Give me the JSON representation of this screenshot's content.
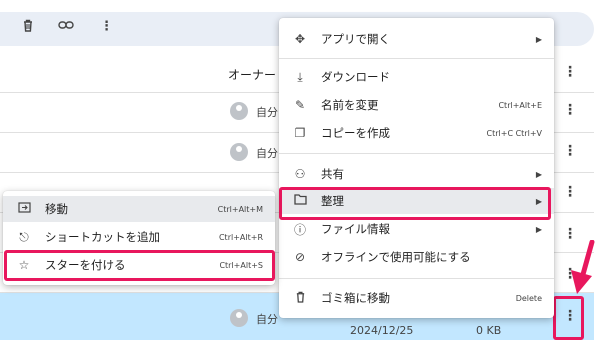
{
  "toolbar": {
    "icons": [
      "trash-icon",
      "link-icon",
      "more-vert-icon"
    ]
  },
  "list": {
    "owner_header": "オーナー",
    "owner_label": "自分",
    "date": "2024/12/25",
    "size": "0 KB"
  },
  "context_menu": {
    "items": [
      {
        "icon": "open-with-icon",
        "label": "アプリで開く",
        "shortcut": "",
        "submenu": true
      },
      {
        "icon": "download-icon",
        "label": "ダウンロード",
        "shortcut": "",
        "submenu": false
      },
      {
        "icon": "rename-icon",
        "label": "名前を変更",
        "shortcut": "Ctrl+Alt+E",
        "submenu": false
      },
      {
        "icon": "copy-icon",
        "label": "コピーを作成",
        "shortcut": "Ctrl+C Ctrl+V",
        "submenu": false
      },
      {
        "icon": "share-icon",
        "label": "共有",
        "shortcut": "",
        "submenu": true
      },
      {
        "icon": "folder-icon",
        "label": "整理",
        "shortcut": "",
        "submenu": true
      },
      {
        "icon": "info-icon",
        "label": "ファイル情報",
        "shortcut": "",
        "submenu": true
      },
      {
        "icon": "offline-icon",
        "label": "オフラインで使用可能にする",
        "shortcut": "",
        "submenu": false
      },
      {
        "icon": "trash-icon",
        "label": "ゴミ箱に移動",
        "shortcut": "Delete",
        "submenu": false
      }
    ]
  },
  "submenu": {
    "items": [
      {
        "icon": "move-icon",
        "label": "移動",
        "shortcut": "Ctrl+Alt+M"
      },
      {
        "icon": "add-shortcut-icon",
        "label": "ショートカットを追加",
        "shortcut": "Ctrl+Alt+R"
      },
      {
        "icon": "star-icon",
        "label": "スターを付ける",
        "shortcut": "Ctrl+Alt+S"
      }
    ]
  },
  "colors": {
    "highlight": "#e8175d",
    "selected_row": "#c2e7ff",
    "hover": "#e8eaed"
  }
}
